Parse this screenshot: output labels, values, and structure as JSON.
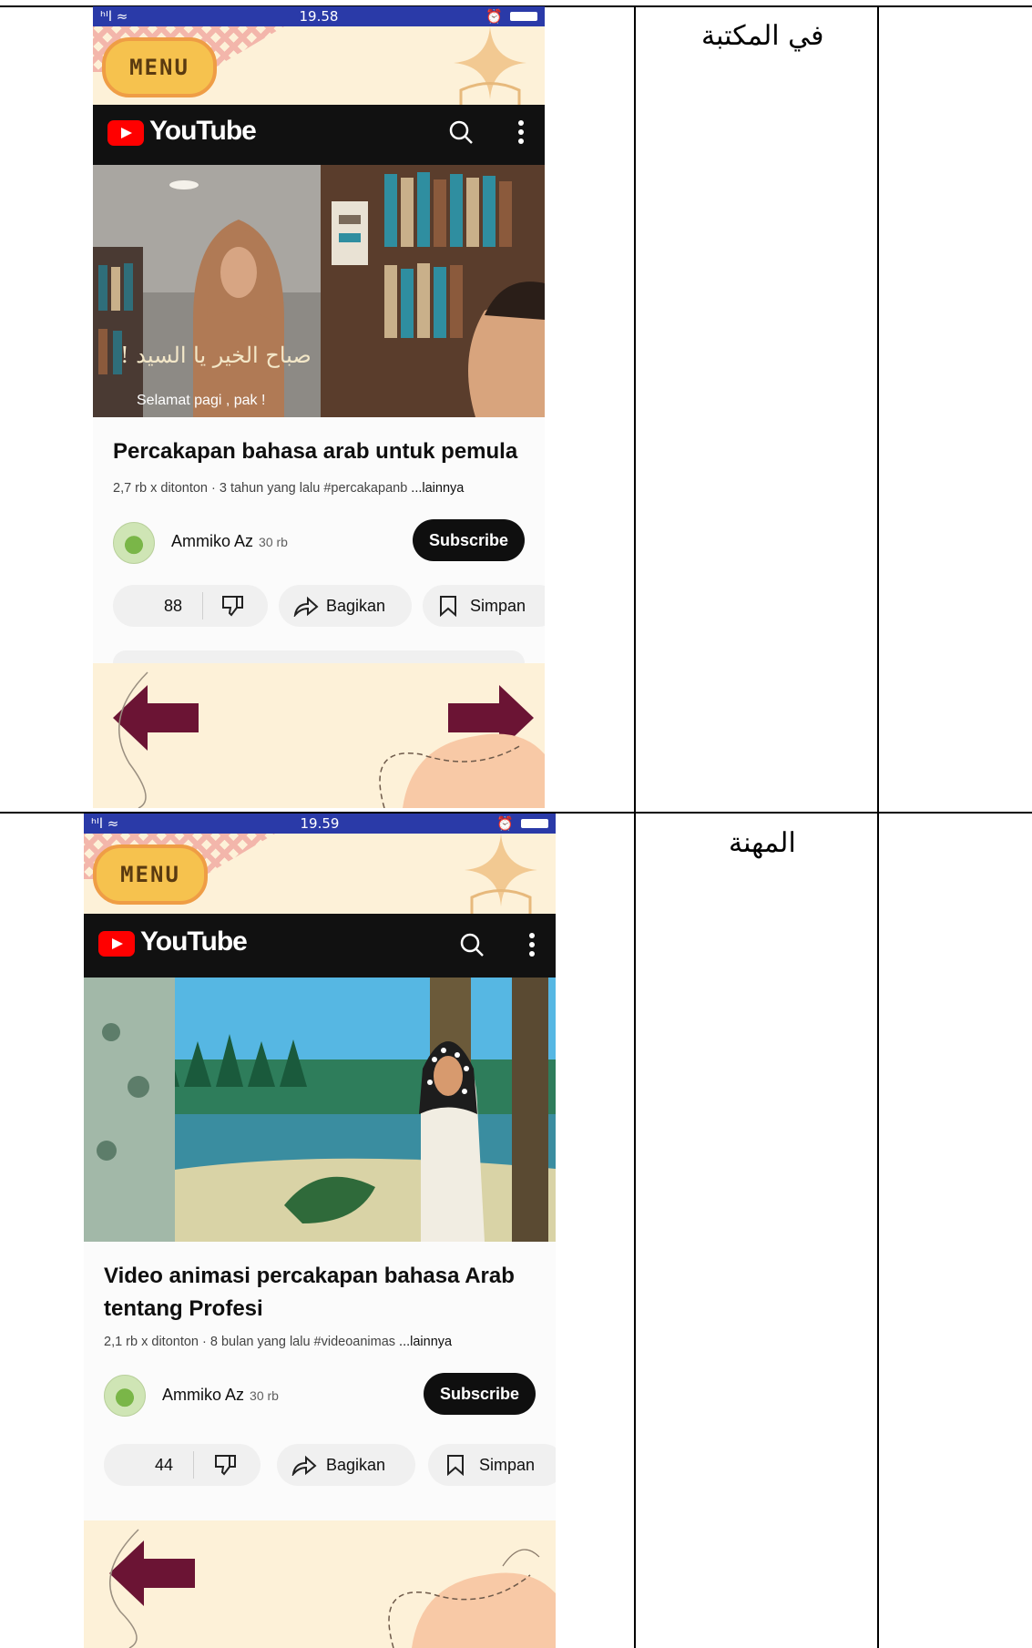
{
  "rows": [
    {
      "label_ar": "في المكتبة",
      "phone": {
        "status_time": "19.58",
        "status_signal": "ʰᴵl ≈",
        "status_alarm": "⏰",
        "menu_label": "MENU",
        "app_name": "YouTube",
        "subtitle_ar": "صباح الخير يا السيد !",
        "subtitle_id": "Selamat pagi , pak !",
        "video_title": "Percakapan bahasa arab untuk pemula",
        "meta": "2,7 rb x ditonton · 3 tahun yang lalu  #percakapanb",
        "meta_more": "...lainnya",
        "channel_name": "Ammiko Az",
        "channel_subs": "30 rb",
        "subscribe_label": "Subscribe",
        "like_count": "88",
        "share_label": "Bagikan",
        "save_label": "Simpan"
      }
    },
    {
      "label_ar": "المهنة",
      "phone": {
        "status_time": "19.59",
        "status_signal": "ʰᴵl ≈",
        "status_alarm": "⏰",
        "menu_label": "MENU",
        "app_name": "YouTube",
        "video_title": "Video animasi percakapan bahasa Arab tentang Profesi",
        "meta": "2,1 rb x ditonton · 8 bulan yang lalu  #videoanimas",
        "meta_more": "...lainnya",
        "channel_name": "Ammiko Az",
        "channel_subs": "30 rb",
        "subscribe_label": "Subscribe",
        "like_count": "44",
        "share_label": "Bagikan",
        "save_label": "Simpan"
      }
    }
  ],
  "colors": {
    "status_bar": "#2a3aa8",
    "deco_bg": "#fdf1d8",
    "menu_yellow": "#f6c24e",
    "arrow": "#6b1434",
    "yt_red": "#ff0000",
    "yt_bar": "#111111"
  },
  "icons": {
    "nav_prev": "arrow-left-icon",
    "nav_next": "arrow-right-icon",
    "search": "search-icon",
    "more": "more-vertical-icon",
    "dislike": "thumbs-down-icon",
    "share": "share-icon",
    "save": "bookmark-icon"
  }
}
